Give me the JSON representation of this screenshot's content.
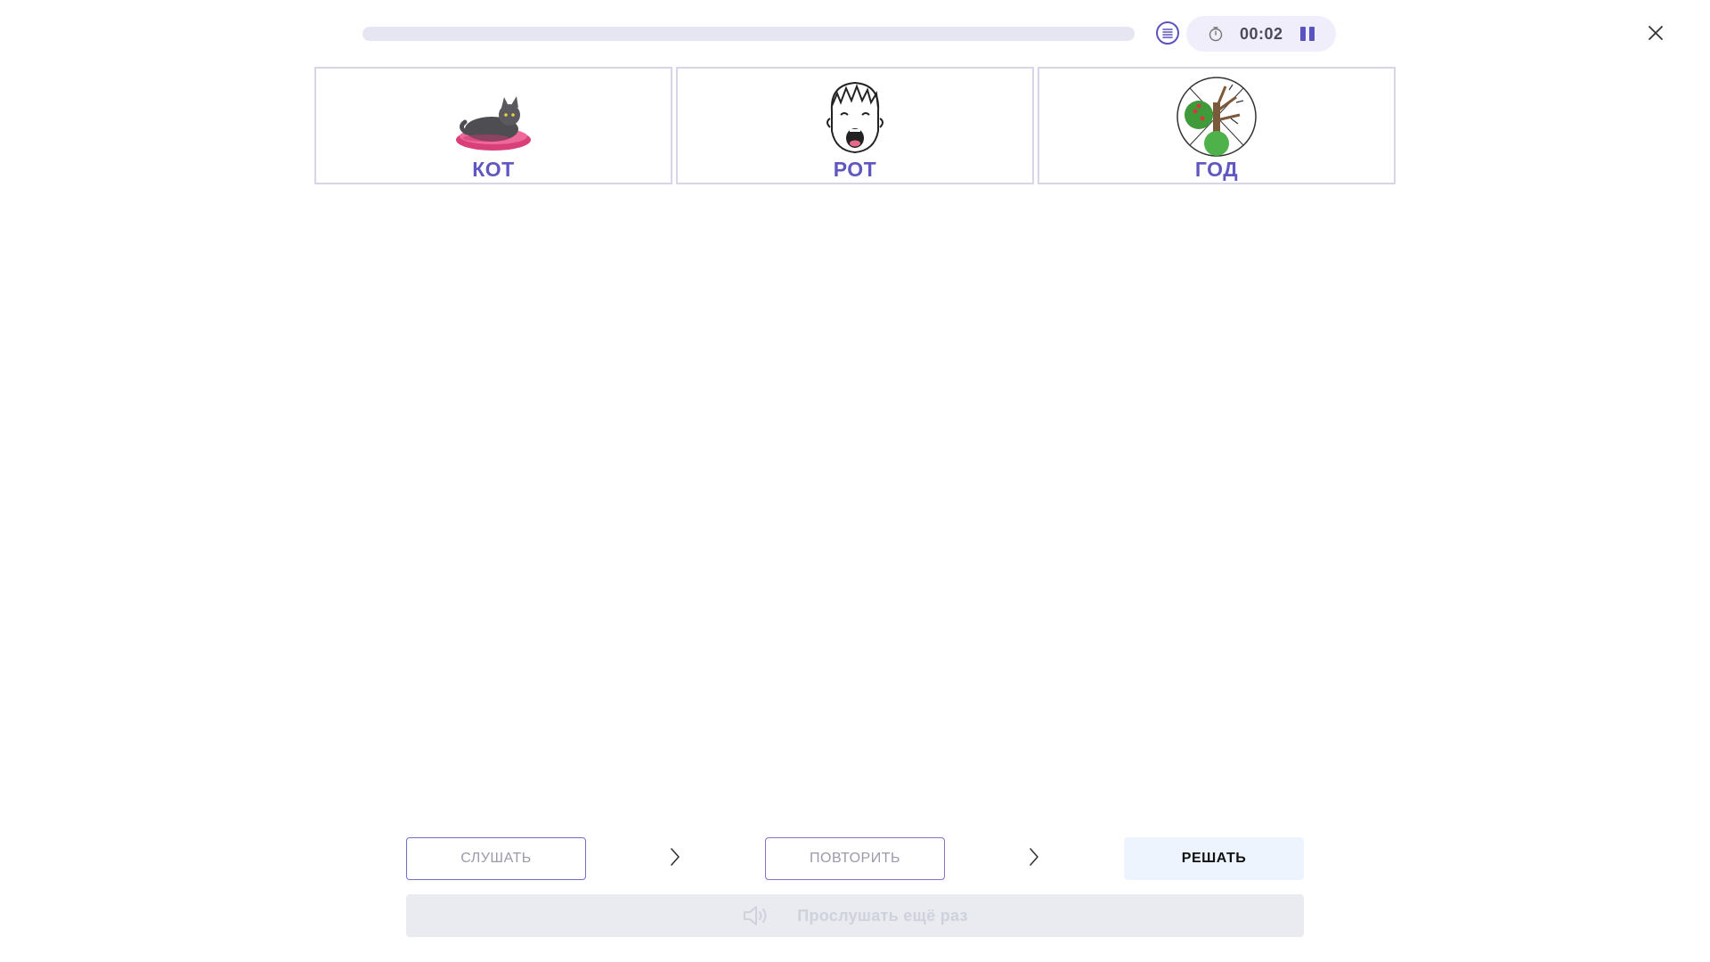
{
  "progress": {
    "fraction": 0.0
  },
  "timer": {
    "time": "00:02"
  },
  "cards": [
    {
      "word": "КОТ",
      "icon": "cat-in-basket-icon"
    },
    {
      "word": "РОТ",
      "icon": "boy-open-mouth-icon"
    },
    {
      "word": "ГОД",
      "icon": "seasons-tree-icon"
    }
  ],
  "steps": {
    "listen_label": "СЛУШАТЬ",
    "repeat_label": "ПОВТОРИТЬ",
    "solve_label": "РЕШАТЬ"
  },
  "replay": {
    "label": "Прослушать ещё раз"
  },
  "colors": {
    "accent": "#5b54c0",
    "word": "#6057c0"
  }
}
